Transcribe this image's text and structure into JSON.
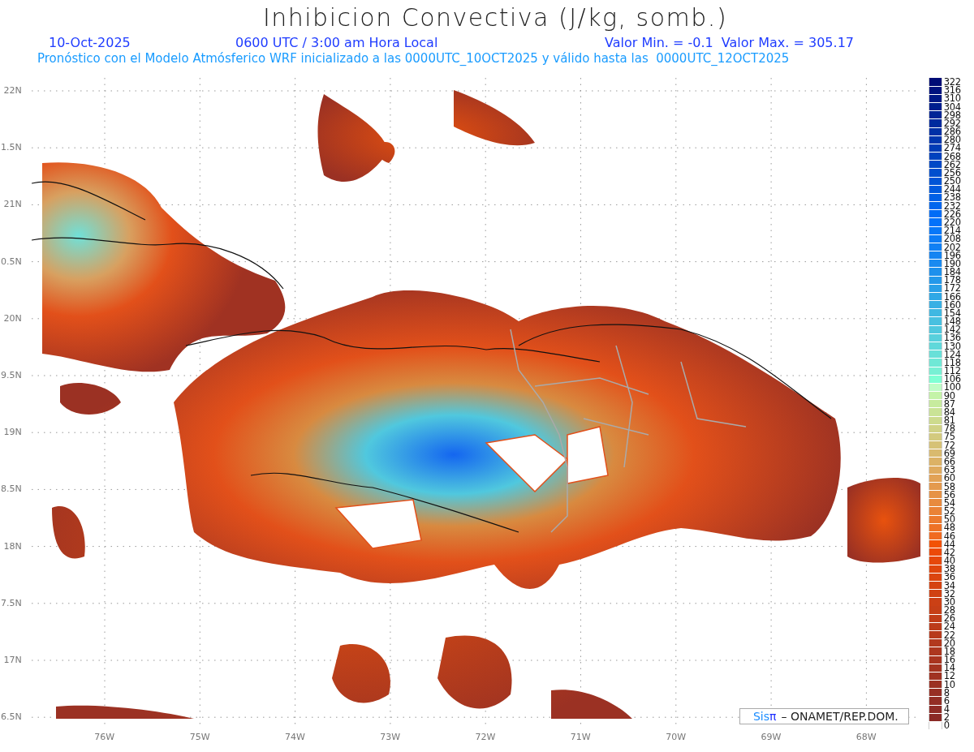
{
  "title": "Inhibicion Convectiva (J/kg, somb.)",
  "subtitle": {
    "date": "10-Oct-2025",
    "time": "0600 UTC / 3:00 am Hora Local",
    "range": "Valor Min. = -0.1  Valor Max. = 305.17"
  },
  "description": "Pronóstico con el Modelo Atmósferico WRF inicializado a las 0000UTC_10OCT2025 y válido hasta las  0000UTC_12OCT2025",
  "y_axis": [
    "22N",
    "1.5N",
    "21N",
    "0.5N",
    "20N",
    "9.5N",
    "19N",
    "8.5N",
    "18N",
    "7.5N",
    "17N",
    "6.5N"
  ],
  "x_axis": [
    "76W",
    "75W",
    "74W",
    "73W",
    "72W",
    "71W",
    "70W",
    "69W",
    "68W"
  ],
  "credit": {
    "brand": "Sis",
    "symbol": "π",
    "text": "– ONAMET/REP.DOM."
  },
  "legend": [
    {
      "label": "322",
      "color": "#000c76"
    },
    {
      "label": "316",
      "color": "#00127e"
    },
    {
      "label": "310",
      "color": "#001886"
    },
    {
      "label": "304",
      "color": "#001e8e"
    },
    {
      "label": "298",
      "color": "#002496"
    },
    {
      "label": "292",
      "color": "#002a9e"
    },
    {
      "label": "286",
      "color": "#0030a6"
    },
    {
      "label": "280",
      "color": "#0036ae"
    },
    {
      "label": "274",
      "color": "#003cb6"
    },
    {
      "label": "268",
      "color": "#0042be"
    },
    {
      "label": "262",
      "color": "#0048c6"
    },
    {
      "label": "256",
      "color": "#004ece"
    },
    {
      "label": "250",
      "color": "#0054d6"
    },
    {
      "label": "244",
      "color": "#005ade"
    },
    {
      "label": "238",
      "color": "#0060e6"
    },
    {
      "label": "232",
      "color": "#0066ee"
    },
    {
      "label": "226",
      "color": "#006cf6"
    },
    {
      "label": "220",
      "color": "#0472fa"
    },
    {
      "label": "214",
      "color": "#0878f8"
    },
    {
      "label": "208",
      "color": "#0c7cf6"
    },
    {
      "label": "202",
      "color": "#1080f4"
    },
    {
      "label": "196",
      "color": "#1584f2"
    },
    {
      "label": "190",
      "color": "#1a8af0"
    },
    {
      "label": "184",
      "color": "#1e90ec"
    },
    {
      "label": "178",
      "color": "#2498ea"
    },
    {
      "label": "172",
      "color": "#2aa0e8"
    },
    {
      "label": "166",
      "color": "#30a8e6"
    },
    {
      "label": "160",
      "color": "#38b0e4"
    },
    {
      "label": "154",
      "color": "#40b8e2"
    },
    {
      "label": "148",
      "color": "#48c0e0"
    },
    {
      "label": "142",
      "color": "#50c8de"
    },
    {
      "label": "136",
      "color": "#58d0dc"
    },
    {
      "label": "130",
      "color": "#60d8da"
    },
    {
      "label": "124",
      "color": "#68e0d8"
    },
    {
      "label": "118",
      "color": "#70e8d6"
    },
    {
      "label": "112",
      "color": "#78f0d4"
    },
    {
      "label": "106",
      "color": "#7fffd4"
    },
    {
      "label": "100",
      "color": "#bffcc6"
    },
    {
      "label": "90",
      "color": "#c4f3a8"
    },
    {
      "label": "87",
      "color": "#c7eb9e"
    },
    {
      "label": "84",
      "color": "#cae396"
    },
    {
      "label": "81",
      "color": "#cddb8e"
    },
    {
      "label": "78",
      "color": "#d0d286"
    },
    {
      "label": "75",
      "color": "#d3ca7e"
    },
    {
      "label": "72",
      "color": "#d6c276"
    },
    {
      "label": "69",
      "color": "#d9ba6e"
    },
    {
      "label": "66",
      "color": "#dcb266"
    },
    {
      "label": "63",
      "color": "#dfaa5e"
    },
    {
      "label": "60",
      "color": "#e2a256"
    },
    {
      "label": "58",
      "color": "#e49a4e"
    },
    {
      "label": "56",
      "color": "#e69246"
    },
    {
      "label": "54",
      "color": "#e88a3e"
    },
    {
      "label": "52",
      "color": "#ea8236"
    },
    {
      "label": "50",
      "color": "#ec7a2e"
    },
    {
      "label": "48",
      "color": "#ee7226"
    },
    {
      "label": "46",
      "color": "#f06a20"
    },
    {
      "label": "44",
      "color": "#f25206"
    },
    {
      "label": "42",
      "color": "#ec4a08"
    },
    {
      "label": "40",
      "color": "#e6480a"
    },
    {
      "label": "38",
      "color": "#e0460c"
    },
    {
      "label": "36",
      "color": "#db450f"
    },
    {
      "label": "34",
      "color": "#d54311"
    },
    {
      "label": "32",
      "color": "#d04213"
    },
    {
      "label": "30",
      "color": "#cb4015"
    },
    {
      "label": "28",
      "color": "#c63f17"
    },
    {
      "label": "26",
      "color": "#c13d19"
    },
    {
      "label": "24",
      "color": "#bc3c1b"
    },
    {
      "label": "22",
      "color": "#b73a1c"
    },
    {
      "label": "20",
      "color": "#b2391e"
    },
    {
      "label": "18",
      "color": "#ad371f"
    },
    {
      "label": "16",
      "color": "#a93520"
    },
    {
      "label": "14",
      "color": "#a43421"
    },
    {
      "label": "12",
      "color": "#a03222"
    },
    {
      "label": "10",
      "color": "#9b3123"
    },
    {
      "label": "8",
      "color": "#972f24"
    },
    {
      "label": "6",
      "color": "#932e25"
    },
    {
      "label": "4",
      "color": "#8f2c26"
    },
    {
      "label": "2",
      "color": "#8b2a26"
    },
    {
      "label": "0",
      "color": "#ffffff"
    }
  ]
}
